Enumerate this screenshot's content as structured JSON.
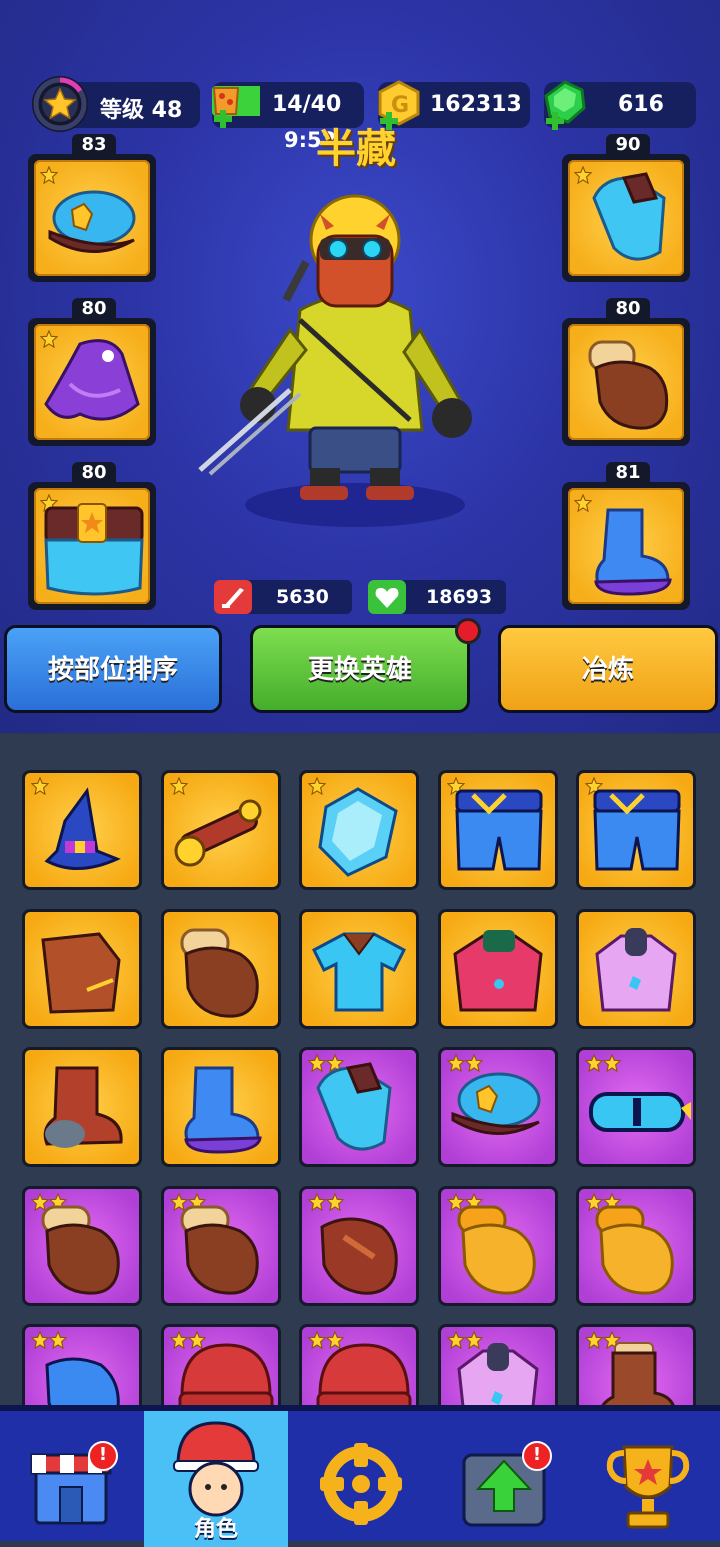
{
  "hud": {
    "level_label": "等级 48",
    "energy": "14/40",
    "energy_timer": "9:52",
    "coins": "162313",
    "gems": "616"
  },
  "hero": {
    "name": "半藏",
    "attack": "5630",
    "health": "18693"
  },
  "equipment": {
    "left": [
      {
        "level": "83",
        "item": "police-cap"
      },
      {
        "level": "80",
        "item": "purple-cloak"
      },
      {
        "level": "80",
        "item": "belt-pants"
      }
    ],
    "right": [
      {
        "level": "90",
        "item": "blue-armor"
      },
      {
        "level": "80",
        "item": "brown-glove"
      },
      {
        "level": "81",
        "item": "blue-boot"
      }
    ]
  },
  "actions": {
    "sort_label": "按部位排序",
    "change_hero_label": "更换英雄",
    "smelt_label": "冶炼"
  },
  "colors": {
    "gold": "#f6ae1a",
    "purple": "#b03fd6",
    "blue_button": "#2f7fe6",
    "green_button": "#57c23f",
    "orange_button": "#f6ae1a"
  },
  "inventory": [
    [
      {
        "rarity": "gold",
        "stars": 1,
        "item": "wizard-hat"
      },
      {
        "rarity": "gold",
        "stars": 1,
        "item": "scope"
      },
      {
        "rarity": "gold",
        "stars": 1,
        "item": "diamond"
      },
      {
        "rarity": "gold",
        "stars": 1,
        "item": "blue-shorts"
      },
      {
        "rarity": "gold",
        "stars": 1,
        "item": "blue-shorts"
      }
    ],
    [
      {
        "rarity": "gold",
        "stars": 0,
        "item": "leather-armor"
      },
      {
        "rarity": "gold",
        "stars": 0,
        "item": "brown-glove"
      },
      {
        "rarity": "gold",
        "stars": 0,
        "item": "blue-shirt"
      },
      {
        "rarity": "gold",
        "stars": 0,
        "item": "red-jacket"
      },
      {
        "rarity": "gold",
        "stars": 0,
        "item": "pink-vest"
      }
    ],
    [
      {
        "rarity": "gold",
        "stars": 0,
        "item": "red-boot"
      },
      {
        "rarity": "gold",
        "stars": 0,
        "item": "blue-boot"
      },
      {
        "rarity": "purple",
        "stars": 2,
        "item": "blue-armor"
      },
      {
        "rarity": "purple",
        "stars": 2,
        "item": "police-cap"
      },
      {
        "rarity": "purple",
        "stars": 2,
        "item": "goggles"
      }
    ],
    [
      {
        "rarity": "purple",
        "stars": 2,
        "item": "brown-glove"
      },
      {
        "rarity": "purple",
        "stars": 2,
        "item": "brown-glove"
      },
      {
        "rarity": "purple",
        "stars": 2,
        "item": "leather-glove"
      },
      {
        "rarity": "purple",
        "stars": 2,
        "item": "yellow-glove"
      },
      {
        "rarity": "purple",
        "stars": 2,
        "item": "yellow-glove"
      }
    ],
    [
      {
        "rarity": "purple",
        "stars": 2,
        "item": "blue-glove"
      },
      {
        "rarity": "purple",
        "stars": 2,
        "item": "red-beanie"
      },
      {
        "rarity": "purple",
        "stars": 2,
        "item": "red-beanie"
      },
      {
        "rarity": "purple",
        "stars": 2,
        "item": "pink-vest"
      },
      {
        "rarity": "purple",
        "stars": 2,
        "item": "brown-boot"
      }
    ]
  ],
  "nav": {
    "items": [
      {
        "name": "shop",
        "label": "",
        "badge": "!"
      },
      {
        "name": "character",
        "label": "角色",
        "badge": ""
      },
      {
        "name": "battle",
        "label": "",
        "badge": ""
      },
      {
        "name": "upgrade",
        "label": "",
        "badge": "!"
      },
      {
        "name": "trophy",
        "label": "",
        "badge": ""
      }
    ]
  }
}
